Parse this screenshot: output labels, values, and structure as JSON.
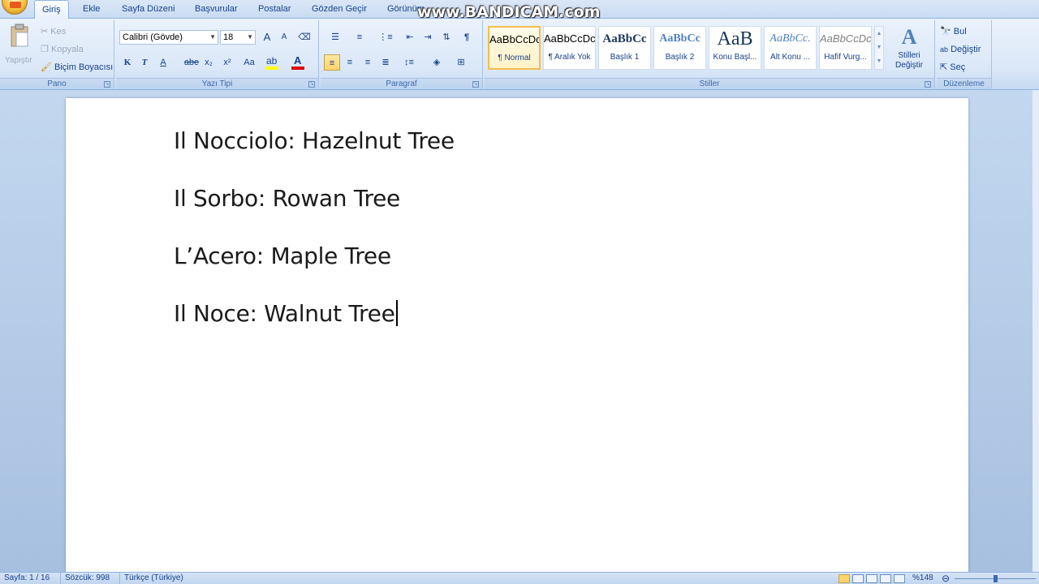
{
  "tabs": [
    "Giriş",
    "Ekle",
    "Sayfa Düzeni",
    "Başvurular",
    "Postalar",
    "Gözden Geçir",
    "Görünüm"
  ],
  "watermark": "www.BANDICAM.com",
  "clipboard": {
    "paste_label": "Yapıştır",
    "cut_label": "Kes",
    "copy_label": "Kopyala",
    "format_painter_label": "Biçim Boyacısı",
    "group_label": "Pano"
  },
  "font": {
    "font_name": "Calibri (Gövde)",
    "font_size": "18",
    "bold": "K",
    "italic": "T",
    "underline": "A",
    "strike": "abe",
    "subscript": "x₂",
    "superscript": "x²",
    "change_case": "Aa",
    "grow": "A",
    "shrink": "A",
    "group_label": "Yazı Tipi"
  },
  "paragraph": {
    "group_label": "Paragraf",
    "pilcrow": "¶"
  },
  "styles": {
    "items": [
      {
        "preview": "AaBbCcDc",
        "name": "¶ Normal"
      },
      {
        "preview": "AaBbCcDc",
        "name": "¶ Aralık Yok"
      },
      {
        "preview": "AaBbCc",
        "name": "Başlık 1"
      },
      {
        "preview": "AaBbCc",
        "name": "Başlık 2"
      },
      {
        "preview": "AaB",
        "name": "Konu Başl..."
      },
      {
        "preview": "AaBbCc.",
        "name": "Alt Konu ..."
      },
      {
        "preview": "AaBbCcDc",
        "name": "Hafif Vurg..."
      }
    ],
    "change_styles_line1": "Stilleri",
    "change_styles_line2": "Değiştir",
    "group_label": "Stiller"
  },
  "editing": {
    "find_label": "Bul",
    "replace_label": "Değiştir",
    "select_label": "Seç",
    "group_label": "Düzenleme"
  },
  "document": {
    "lines": [
      "Il Nocciolo: Hazelnut Tree",
      "Il Sorbo: Rowan Tree",
      "L’Acero: Maple Tree",
      "Il Noce: Walnut Tree"
    ]
  },
  "status": {
    "page": "Sayfa: 1 / 16",
    "words": "Sözcük: 998",
    "language": "Türkçe (Türkiye)",
    "zoom": "%148"
  },
  "colors": {
    "highlight": "#ffff00",
    "font_color": "#e00000",
    "selected_style_border": "#f2be4d"
  }
}
